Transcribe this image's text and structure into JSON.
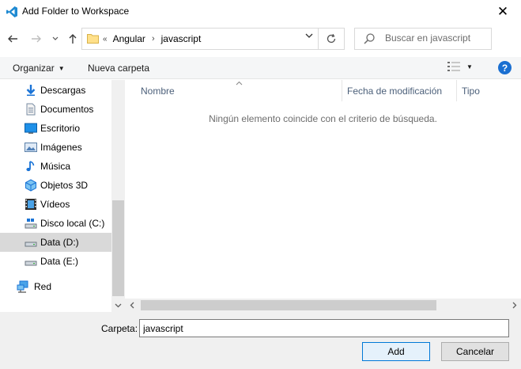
{
  "window": {
    "title": "Add Folder to Workspace",
    "close_glyph": "✕",
    "accent": "#0078d7"
  },
  "address": {
    "overflow": "«",
    "crumbs": [
      "Angular",
      "javascript"
    ],
    "separator": "›"
  },
  "search": {
    "placeholder": "Buscar en javascript"
  },
  "toolbar": {
    "organize_label": "Organizar",
    "new_folder_label": "Nueva carpeta",
    "help_glyph": "?"
  },
  "sidebar": {
    "items": [
      {
        "label": "Descargas",
        "icon": "download-icon"
      },
      {
        "label": "Documentos",
        "icon": "document-icon"
      },
      {
        "label": "Escritorio",
        "icon": "desktop-icon"
      },
      {
        "label": "Imágenes",
        "icon": "pictures-icon"
      },
      {
        "label": "Música",
        "icon": "music-icon"
      },
      {
        "label": "Objetos 3D",
        "icon": "cube-icon"
      },
      {
        "label": "Vídeos",
        "icon": "video-icon"
      },
      {
        "label": "Disco local (C:)",
        "icon": "drive-icon"
      },
      {
        "label": "Data (D:)",
        "icon": "drive-icon",
        "selected": true
      },
      {
        "label": "Data (E:)",
        "icon": "drive-icon"
      },
      {
        "label": "Red",
        "icon": "network-icon"
      }
    ]
  },
  "filelist": {
    "columns": [
      "Nombre",
      "Fecha de modificación",
      "Tipo"
    ],
    "empty_message": "Ningún elemento coincide con el criterio de búsqueda."
  },
  "footer": {
    "folder_label": "Carpeta:",
    "folder_value": "javascript",
    "add_label": "Add",
    "cancel_label": "Cancelar"
  }
}
